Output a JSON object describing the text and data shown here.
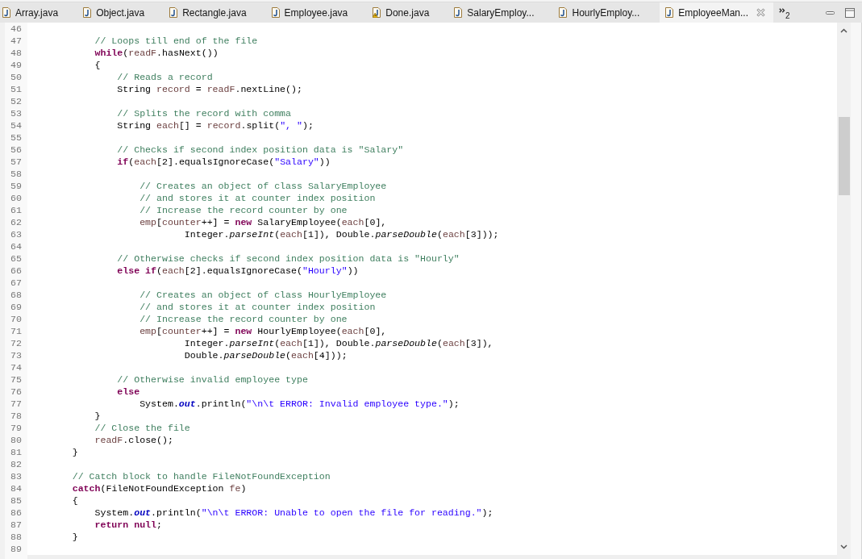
{
  "tabs": [
    {
      "label": "Array.java",
      "warning": false,
      "selected": false
    },
    {
      "label": "Object.java",
      "warning": false,
      "selected": false
    },
    {
      "label": "Rectangle.java",
      "warning": false,
      "selected": false
    },
    {
      "label": "Employee.java",
      "warning": false,
      "selected": false
    },
    {
      "label": "Done.java",
      "warning": true,
      "selected": false
    },
    {
      "label": "SalaryEmploy...",
      "warning": false,
      "selected": false
    },
    {
      "label": "HourlyEmploy...",
      "warning": false,
      "selected": false
    },
    {
      "label": "EmployeeMan...",
      "warning": false,
      "selected": true
    }
  ],
  "hidden_tab_count": "2",
  "lines": [
    {
      "number": "46"
    },
    {
      "number": "47",
      "tokens": [
        {
          "kind": "comment",
          "text": "\t\t\t// Loops till end of the file"
        }
      ]
    },
    {
      "number": "48",
      "tokens": [
        {
          "kind": "keyword",
          "text": "\t\t\twhile"
        },
        {
          "kind": "plain",
          "text": "("
        },
        {
          "kind": "local",
          "text": "readF"
        },
        {
          "kind": "plain",
          "text": ".hasNext())"
        }
      ]
    },
    {
      "number": "49",
      "tokens": [
        {
          "kind": "plain",
          "text": "\t\t\t{"
        }
      ]
    },
    {
      "number": "50",
      "tokens": [
        {
          "kind": "comment",
          "text": "\t\t\t\t// Reads a record"
        }
      ]
    },
    {
      "number": "51",
      "tokens": [
        {
          "kind": "plain",
          "text": "\t\t\t\tString "
        },
        {
          "kind": "local",
          "text": "record"
        },
        {
          "kind": "plain",
          "text": " = "
        },
        {
          "kind": "local",
          "text": "readF"
        },
        {
          "kind": "plain",
          "text": ".nextLine();"
        }
      ]
    },
    {
      "number": "52"
    },
    {
      "number": "53",
      "tokens": [
        {
          "kind": "comment",
          "text": "\t\t\t\t// Splits the record with comma"
        }
      ]
    },
    {
      "number": "54",
      "tokens": [
        {
          "kind": "plain",
          "text": "\t\t\t\tString "
        },
        {
          "kind": "local",
          "text": "each"
        },
        {
          "kind": "plain",
          "text": "[] = "
        },
        {
          "kind": "local",
          "text": "record"
        },
        {
          "kind": "plain",
          "text": ".split("
        },
        {
          "kind": "string",
          "text": "\", \""
        },
        {
          "kind": "plain",
          "text": ");"
        }
      ]
    },
    {
      "number": "55"
    },
    {
      "number": "56",
      "tokens": [
        {
          "kind": "comment",
          "text": "\t\t\t\t// Checks if second index position data is \"Salary\""
        }
      ]
    },
    {
      "number": "57",
      "tokens": [
        {
          "kind": "keyword",
          "text": "\t\t\t\tif"
        },
        {
          "kind": "plain",
          "text": "("
        },
        {
          "kind": "local",
          "text": "each"
        },
        {
          "kind": "plain",
          "text": "[2].equalsIgnoreCase("
        },
        {
          "kind": "string",
          "text": "\"Salary\""
        },
        {
          "kind": "plain",
          "text": "))"
        }
      ]
    },
    {
      "number": "58"
    },
    {
      "number": "59",
      "tokens": [
        {
          "kind": "comment",
          "text": "\t\t\t\t\t// Creates an object of class SalaryEmployee"
        }
      ]
    },
    {
      "number": "60",
      "tokens": [
        {
          "kind": "comment",
          "text": "\t\t\t\t\t// and stores it at counter index position"
        }
      ]
    },
    {
      "number": "61",
      "tokens": [
        {
          "kind": "comment",
          "text": "\t\t\t\t\t// Increase the record counter by one"
        }
      ]
    },
    {
      "number": "62",
      "tokens": [
        {
          "kind": "local",
          "text": "\t\t\t\t\temp"
        },
        {
          "kind": "plain",
          "text": "["
        },
        {
          "kind": "local",
          "text": "counter"
        },
        {
          "kind": "plain",
          "text": "++] = "
        },
        {
          "kind": "keyword",
          "text": "new"
        },
        {
          "kind": "plain",
          "text": " SalaryEmployee("
        },
        {
          "kind": "local",
          "text": "each"
        },
        {
          "kind": "plain",
          "text": "[0],"
        }
      ]
    },
    {
      "number": "63",
      "tokens": [
        {
          "kind": "plain",
          "text": "\t\t\t\t\t\t\tInteger."
        },
        {
          "kind": "static_method",
          "text": "parseInt"
        },
        {
          "kind": "plain",
          "text": "("
        },
        {
          "kind": "local",
          "text": "each"
        },
        {
          "kind": "plain",
          "text": "[1]), Double."
        },
        {
          "kind": "static_method",
          "text": "parseDouble"
        },
        {
          "kind": "plain",
          "text": "("
        },
        {
          "kind": "local",
          "text": "each"
        },
        {
          "kind": "plain",
          "text": "[3]));"
        }
      ]
    },
    {
      "number": "64"
    },
    {
      "number": "65",
      "tokens": [
        {
          "kind": "comment",
          "text": "\t\t\t\t// Otherwise checks if second index position data is \"Hourly\""
        }
      ]
    },
    {
      "number": "66",
      "tokens": [
        {
          "kind": "keyword",
          "text": "\t\t\t\telse if"
        },
        {
          "kind": "plain",
          "text": "("
        },
        {
          "kind": "local",
          "text": "each"
        },
        {
          "kind": "plain",
          "text": "[2].equalsIgnoreCase("
        },
        {
          "kind": "string",
          "text": "\"Hourly\""
        },
        {
          "kind": "plain",
          "text": "))"
        }
      ]
    },
    {
      "number": "67"
    },
    {
      "number": "68",
      "tokens": [
        {
          "kind": "comment",
          "text": "\t\t\t\t\t// Creates an object of class HourlyEmployee"
        }
      ]
    },
    {
      "number": "69",
      "tokens": [
        {
          "kind": "comment",
          "text": "\t\t\t\t\t// and stores it at counter index position"
        }
      ]
    },
    {
      "number": "70",
      "tokens": [
        {
          "kind": "comment",
          "text": "\t\t\t\t\t// Increase the record counter by one"
        }
      ]
    },
    {
      "number": "71",
      "tokens": [
        {
          "kind": "local",
          "text": "\t\t\t\t\temp"
        },
        {
          "kind": "plain",
          "text": "["
        },
        {
          "kind": "local",
          "text": "counter"
        },
        {
          "kind": "plain",
          "text": "++] = "
        },
        {
          "kind": "keyword",
          "text": "new"
        },
        {
          "kind": "plain",
          "text": " HourlyEmployee("
        },
        {
          "kind": "local",
          "text": "each"
        },
        {
          "kind": "plain",
          "text": "[0],"
        }
      ]
    },
    {
      "number": "72",
      "tokens": [
        {
          "kind": "plain",
          "text": "\t\t\t\t\t\t\tInteger."
        },
        {
          "kind": "static_method",
          "text": "parseInt"
        },
        {
          "kind": "plain",
          "text": "("
        },
        {
          "kind": "local",
          "text": "each"
        },
        {
          "kind": "plain",
          "text": "[1]), Double."
        },
        {
          "kind": "static_method",
          "text": "parseDouble"
        },
        {
          "kind": "plain",
          "text": "("
        },
        {
          "kind": "local",
          "text": "each"
        },
        {
          "kind": "plain",
          "text": "[3]),"
        }
      ]
    },
    {
      "number": "73",
      "tokens": [
        {
          "kind": "plain",
          "text": "\t\t\t\t\t\t\tDouble."
        },
        {
          "kind": "static_method",
          "text": "parseDouble"
        },
        {
          "kind": "plain",
          "text": "("
        },
        {
          "kind": "local",
          "text": "each"
        },
        {
          "kind": "plain",
          "text": "[4]));"
        }
      ]
    },
    {
      "number": "74"
    },
    {
      "number": "75",
      "tokens": [
        {
          "kind": "comment",
          "text": "\t\t\t\t// Otherwise invalid employee type"
        }
      ]
    },
    {
      "number": "76",
      "tokens": [
        {
          "kind": "keyword",
          "text": "\t\t\t\telse"
        }
      ]
    },
    {
      "number": "77",
      "tokens": [
        {
          "kind": "plain",
          "text": "\t\t\t\t\tSystem."
        },
        {
          "kind": "static_field",
          "text": "out"
        },
        {
          "kind": "plain",
          "text": ".println("
        },
        {
          "kind": "string",
          "text": "\"\\n\\t ERROR: Invalid employee type.\""
        },
        {
          "kind": "plain",
          "text": ");"
        }
      ]
    },
    {
      "number": "78",
      "tokens": [
        {
          "kind": "plain",
          "text": "\t\t\t}"
        }
      ]
    },
    {
      "number": "79",
      "tokens": [
        {
          "kind": "comment",
          "text": "\t\t\t// Close the file"
        }
      ]
    },
    {
      "number": "80",
      "tokens": [
        {
          "kind": "local",
          "text": "\t\t\treadF"
        },
        {
          "kind": "plain",
          "text": ".close();"
        }
      ]
    },
    {
      "number": "81",
      "tokens": [
        {
          "kind": "plain",
          "text": "\t\t}"
        }
      ]
    },
    {
      "number": "82"
    },
    {
      "number": "83",
      "tokens": [
        {
          "kind": "comment",
          "text": "\t\t// Catch block to handle FileNotFoundException"
        }
      ]
    },
    {
      "number": "84",
      "tokens": [
        {
          "kind": "keyword",
          "text": "\t\tcatch"
        },
        {
          "kind": "plain",
          "text": "(FileNotFoundException "
        },
        {
          "kind": "local",
          "text": "fe"
        },
        {
          "kind": "plain",
          "text": ")"
        }
      ]
    },
    {
      "number": "85",
      "tokens": [
        {
          "kind": "plain",
          "text": "\t\t{"
        }
      ]
    },
    {
      "number": "86",
      "tokens": [
        {
          "kind": "plain",
          "text": "\t\t\tSystem."
        },
        {
          "kind": "static_field",
          "text": "out"
        },
        {
          "kind": "plain",
          "text": ".println("
        },
        {
          "kind": "string",
          "text": "\"\\n\\t ERROR: Unable to open the file for reading.\""
        },
        {
          "kind": "plain",
          "text": ");"
        }
      ]
    },
    {
      "number": "87",
      "tokens": [
        {
          "kind": "keyword",
          "text": "\t\t\treturn null"
        },
        {
          "kind": "plain",
          "text": ";"
        }
      ]
    },
    {
      "number": "88",
      "tokens": [
        {
          "kind": "plain",
          "text": "\t\t}"
        }
      ]
    },
    {
      "number": "89"
    }
  ]
}
